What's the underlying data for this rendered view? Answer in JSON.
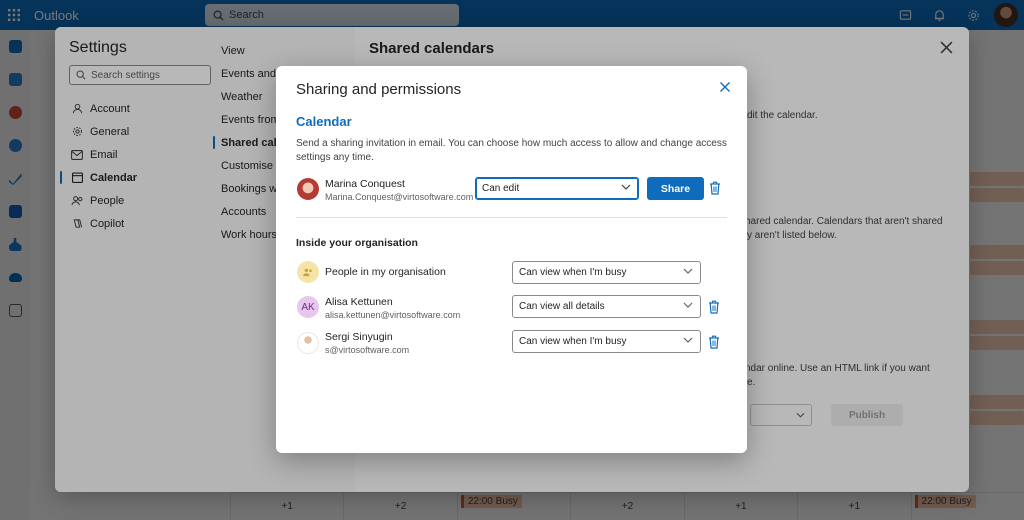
{
  "app": {
    "name": "Outlook",
    "search_placeholder": "Search"
  },
  "settings": {
    "title": "Settings",
    "search_placeholder": "Search settings",
    "nav": [
      "Account",
      "General",
      "Email",
      "Calendar",
      "People",
      "Copilot"
    ],
    "active_nav": "Calendar",
    "subnav": [
      "View",
      "Events and i",
      "Weather",
      "Events from",
      "Shared calen",
      "Customise a",
      "Bookings wi",
      "Accounts",
      "Work hours"
    ],
    "active_subnav": "Shared calen",
    "panel_title": "Shared calendars",
    "bg_text_1": "dit the calendar.",
    "bg_text_2": "hared calendar. Calendars that aren't shared",
    "bg_text_3": "y aren't listed below.",
    "bg_text_4": "ndar online. Use an HTML link if you want",
    "bg_text_5": "e.",
    "publish_label": "Publish"
  },
  "calendar_bg": {
    "cols": [
      "+1",
      "+2",
      "22:00 Busy",
      "+2",
      "+1",
      "+1",
      "22:00 Busy"
    ]
  },
  "modal": {
    "title": "Sharing and permissions",
    "section": "Calendar",
    "description": "Send a sharing invitation in email. You can choose how much access to allow and change access settings any time.",
    "invitee": {
      "name": "Marina Conquest",
      "email": "Marina.Conquest@virtosoftware.com",
      "permission": "Can edit"
    },
    "share_label": "Share",
    "inside_title": "Inside your organisation",
    "members": [
      {
        "name": "People in my organisation",
        "email": "",
        "permission": "Can view when I'm busy",
        "initials": ""
      },
      {
        "name": "Alisa Kettunen",
        "email": "alisa.kettunen@virtosoftware.com",
        "permission": "Can view all details",
        "initials": "AK"
      },
      {
        "name": "Sergi Sinyugin",
        "email": "s@virtosoftware.com",
        "permission": "Can view when I'm busy",
        "initials": ""
      }
    ]
  },
  "colors": {
    "accent": "#0f6cbd",
    "busy": "#f3c4a7"
  }
}
